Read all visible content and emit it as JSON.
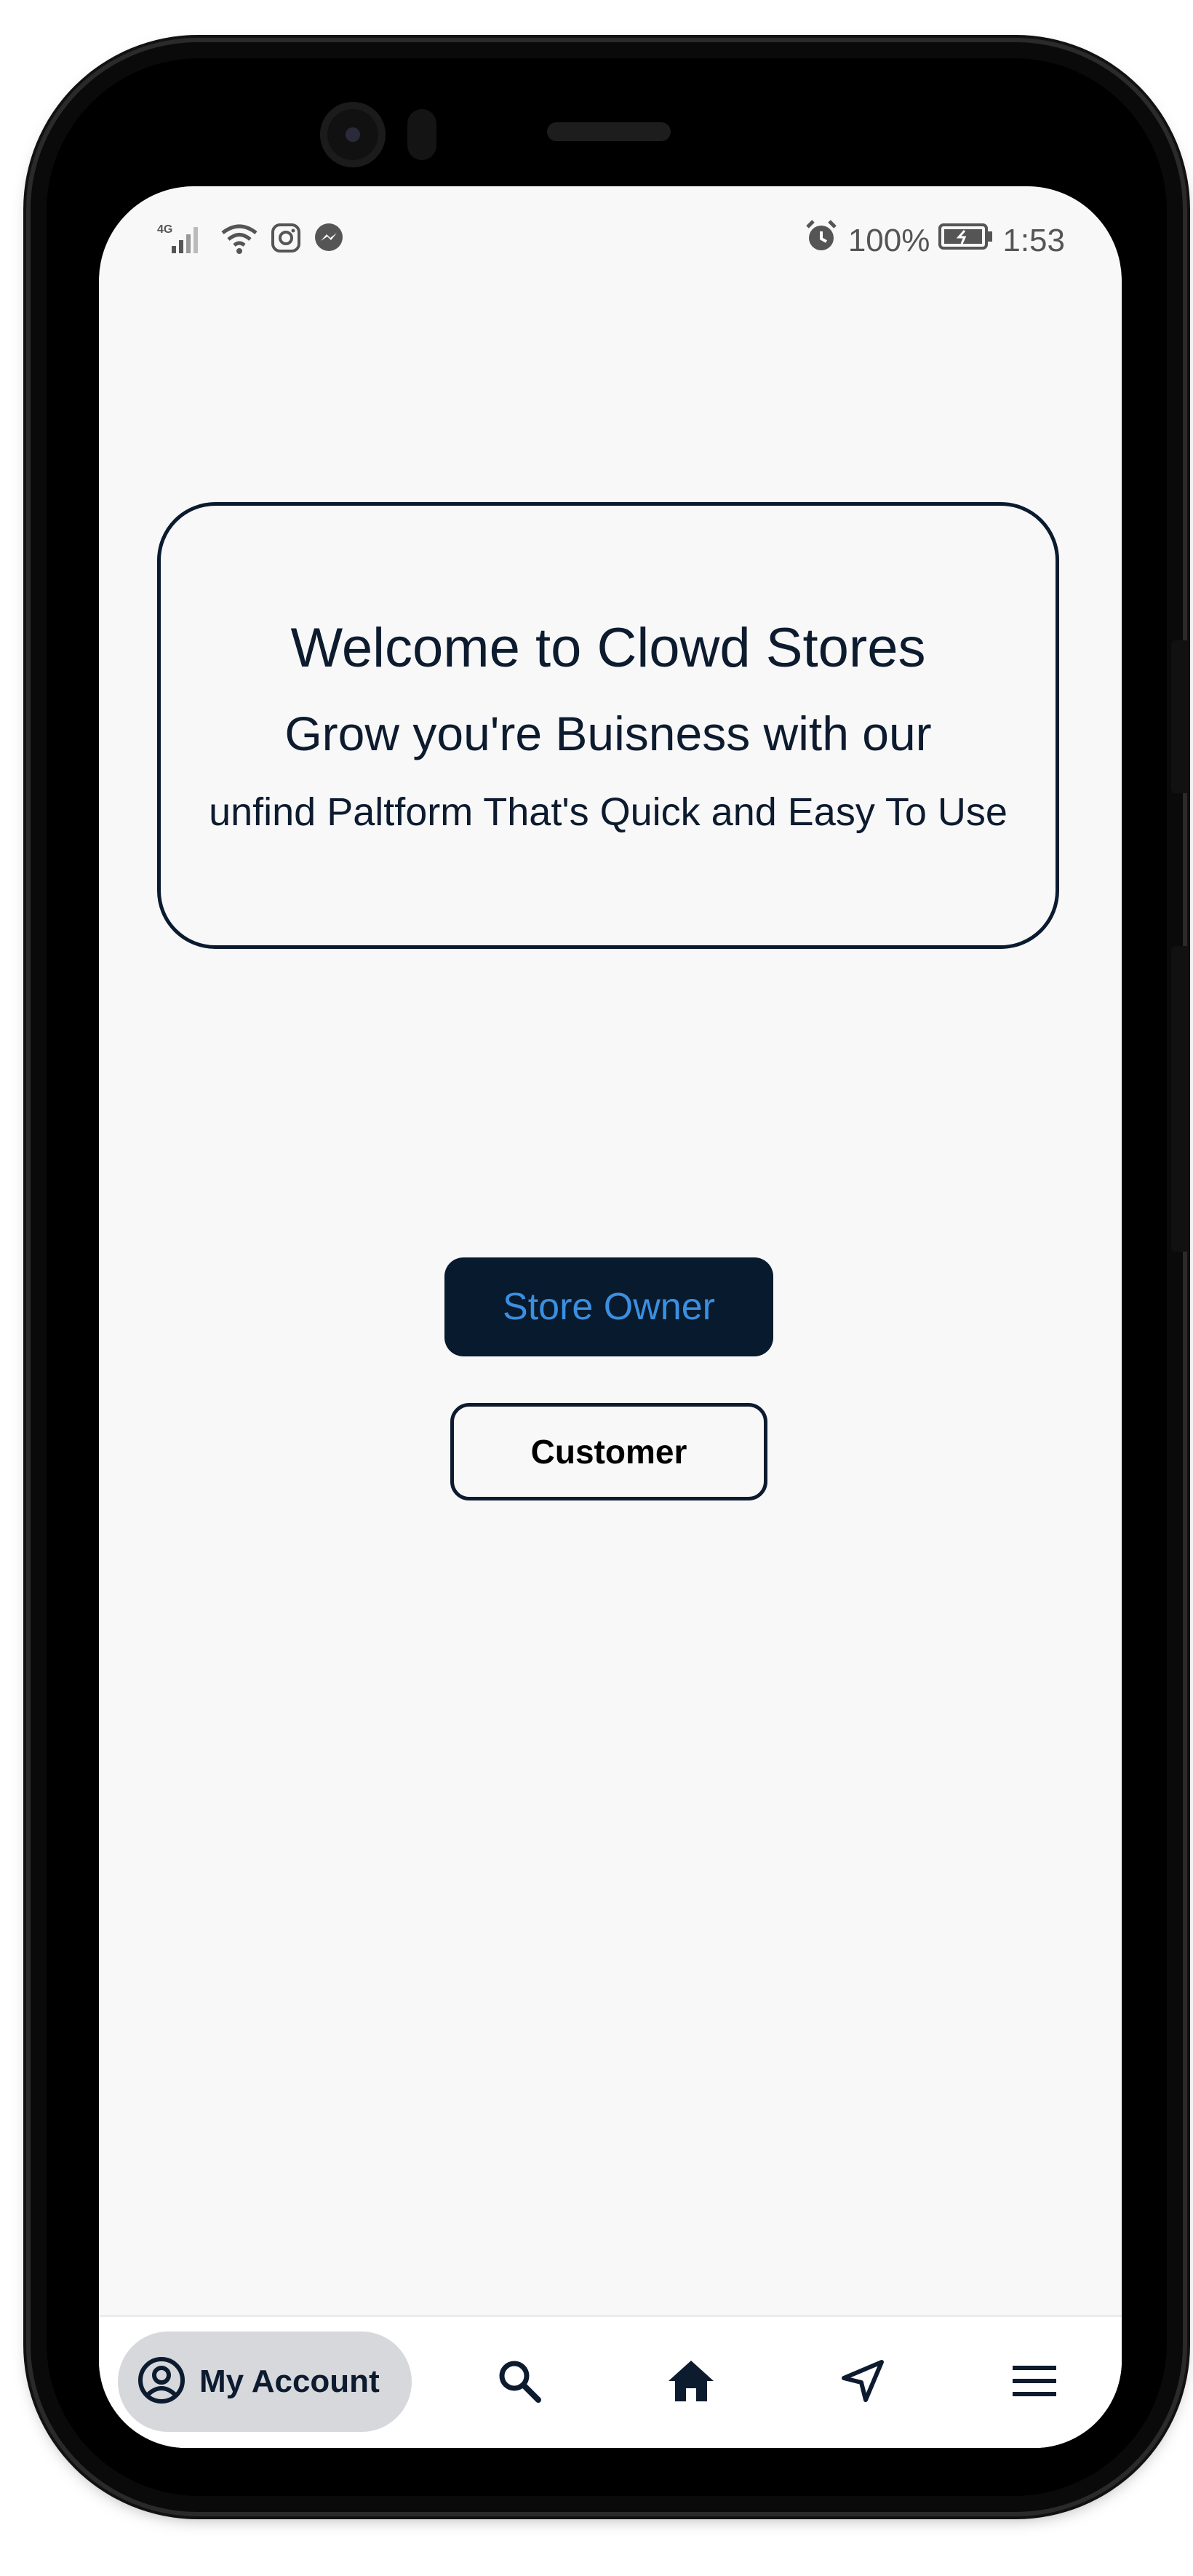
{
  "status_bar": {
    "network": "4G",
    "battery": "100%",
    "time": "1:53",
    "left_icons": [
      "signal-icon",
      "wifi-icon",
      "instagram-icon",
      "messenger-icon"
    ],
    "right_icons": [
      "alarm-icon",
      "battery-icon"
    ]
  },
  "welcome": {
    "title": "Welcome to Clowd Stores",
    "line2": "Grow you're Buisness with our",
    "line3": "unfind Paltform That's Quick and Easy To Use"
  },
  "buttons": {
    "store_owner": "Store Owner",
    "customer": "Customer"
  },
  "bottom_nav": {
    "account_label": "My Account",
    "items": [
      "account-icon",
      "search-icon",
      "home-icon",
      "send-icon",
      "menu-icon"
    ]
  },
  "colors": {
    "navy": "#081a2e",
    "accent_blue": "#3b8fe0",
    "screen_bg": "#f8f8f8",
    "nav_pill": "#d6d8dc"
  }
}
